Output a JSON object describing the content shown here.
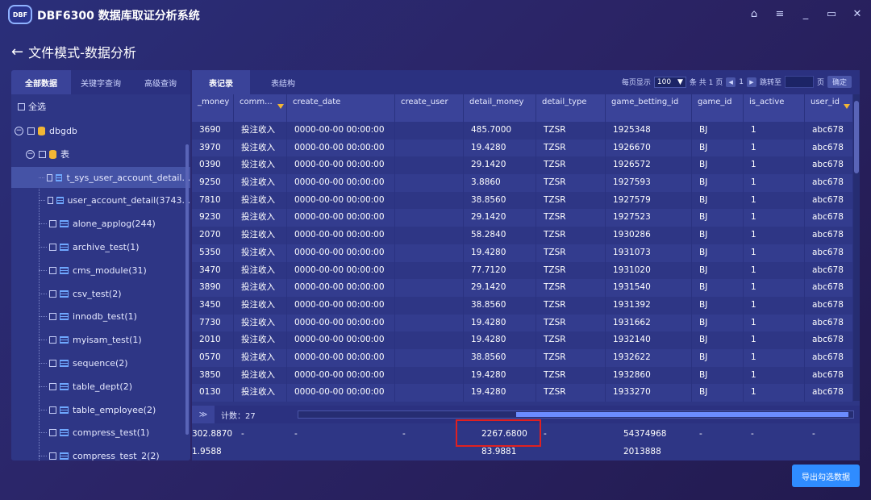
{
  "app": {
    "logo_text": "DBF",
    "title": "DBF6300 数据库取证分析系统"
  },
  "window_controls": {
    "home": "⌂",
    "menu": "≡",
    "minimize": "_",
    "maximize": "▭",
    "close": "✕"
  },
  "page": {
    "back": "←",
    "title": "文件模式-数据分析"
  },
  "left_tabs": [
    "全部数据",
    "关键字查询",
    "高级查询"
  ],
  "tree": {
    "select_all": "全选",
    "db_name": "dbgdb",
    "table_group": "表",
    "tables": [
      "t_sys_user_account_detail...",
      "user_account_detail(3743...",
      "alone_applog(244)",
      "archive_test(1)",
      "cms_module(31)",
      "csv_test(2)",
      "innodb_test(1)",
      "myisam_test(1)",
      "sequence(2)",
      "table_dept(2)",
      "table_employee(2)",
      "compress_test(1)",
      "compress_test_2(2)"
    ]
  },
  "right_tabs": [
    "表记录",
    "表结构"
  ],
  "pager": {
    "per_page_label": "每页显示",
    "per_page_value": "100",
    "summary": "条 共 1 页",
    "current_page": "1",
    "goto_label": "跳转至",
    "page_unit": "页",
    "confirm": "确定"
  },
  "columns": [
    "_money",
    "comm...",
    "create_date",
    "create_user",
    "detail_money",
    "detail_type",
    "game_betting_id",
    "game_id",
    "is_active",
    "user_id"
  ],
  "rows": [
    [
      "3690",
      "投注收入",
      "0000-00-00 00:00:00",
      "",
      "485.7000",
      "TZSR",
      "1925348",
      "BJ",
      "1",
      "abc678"
    ],
    [
      "3970",
      "投注收入",
      "0000-00-00 00:00:00",
      "",
      "19.4280",
      "TZSR",
      "1926670",
      "BJ",
      "1",
      "abc678"
    ],
    [
      "0390",
      "投注收入",
      "0000-00-00 00:00:00",
      "",
      "29.1420",
      "TZSR",
      "1926572",
      "BJ",
      "1",
      "abc678"
    ],
    [
      "9250",
      "投注收入",
      "0000-00-00 00:00:00",
      "",
      "3.8860",
      "TZSR",
      "1927593",
      "BJ",
      "1",
      "abc678"
    ],
    [
      "7810",
      "投注收入",
      "0000-00-00 00:00:00",
      "",
      "38.8560",
      "TZSR",
      "1927579",
      "BJ",
      "1",
      "abc678"
    ],
    [
      "9230",
      "投注收入",
      "0000-00-00 00:00:00",
      "",
      "29.1420",
      "TZSR",
      "1927523",
      "BJ",
      "1",
      "abc678"
    ],
    [
      "2070",
      "投注收入",
      "0000-00-00 00:00:00",
      "",
      "58.2840",
      "TZSR",
      "1930286",
      "BJ",
      "1",
      "abc678"
    ],
    [
      "5350",
      "投注收入",
      "0000-00-00 00:00:00",
      "",
      "19.4280",
      "TZSR",
      "1931073",
      "BJ",
      "1",
      "abc678"
    ],
    [
      "3470",
      "投注收入",
      "0000-00-00 00:00:00",
      "",
      "77.7120",
      "TZSR",
      "1931020",
      "BJ",
      "1",
      "abc678"
    ],
    [
      "3890",
      "投注收入",
      "0000-00-00 00:00:00",
      "",
      "29.1420",
      "TZSR",
      "1931540",
      "BJ",
      "1",
      "abc678"
    ],
    [
      "3450",
      "投注收入",
      "0000-00-00 00:00:00",
      "",
      "38.8560",
      "TZSR",
      "1931392",
      "BJ",
      "1",
      "abc678"
    ],
    [
      "7730",
      "投注收入",
      "0000-00-00 00:00:00",
      "",
      "19.4280",
      "TZSR",
      "1931662",
      "BJ",
      "1",
      "abc678"
    ],
    [
      "2010",
      "投注收入",
      "0000-00-00 00:00:00",
      "",
      "19.4280",
      "TZSR",
      "1932140",
      "BJ",
      "1",
      "abc678"
    ],
    [
      "0570",
      "投注收入",
      "0000-00-00 00:00:00",
      "",
      "38.8560",
      "TZSR",
      "1932622",
      "BJ",
      "1",
      "abc678"
    ],
    [
      "3850",
      "投注收入",
      "0000-00-00 00:00:00",
      "",
      "19.4280",
      "TZSR",
      "1932860",
      "BJ",
      "1",
      "abc678"
    ],
    [
      "0130",
      "投注收入",
      "0000-00-00 00:00:00",
      "",
      "19.4280",
      "TZSR",
      "1933270",
      "BJ",
      "1",
      "abc678"
    ]
  ],
  "footer": {
    "collapse": "≫",
    "count_label": "计数：27"
  },
  "summary_rows": [
    [
      "302.8870",
      "-",
      "-",
      "-",
      "2267.6800",
      "-",
      "54374968",
      "-",
      "-",
      "-"
    ],
    [
      "1.9588",
      "",
      "",
      "",
      "83.9881",
      "",
      "2013888",
      "",
      "",
      ""
    ]
  ],
  "export_button": "导出勾选数据"
}
